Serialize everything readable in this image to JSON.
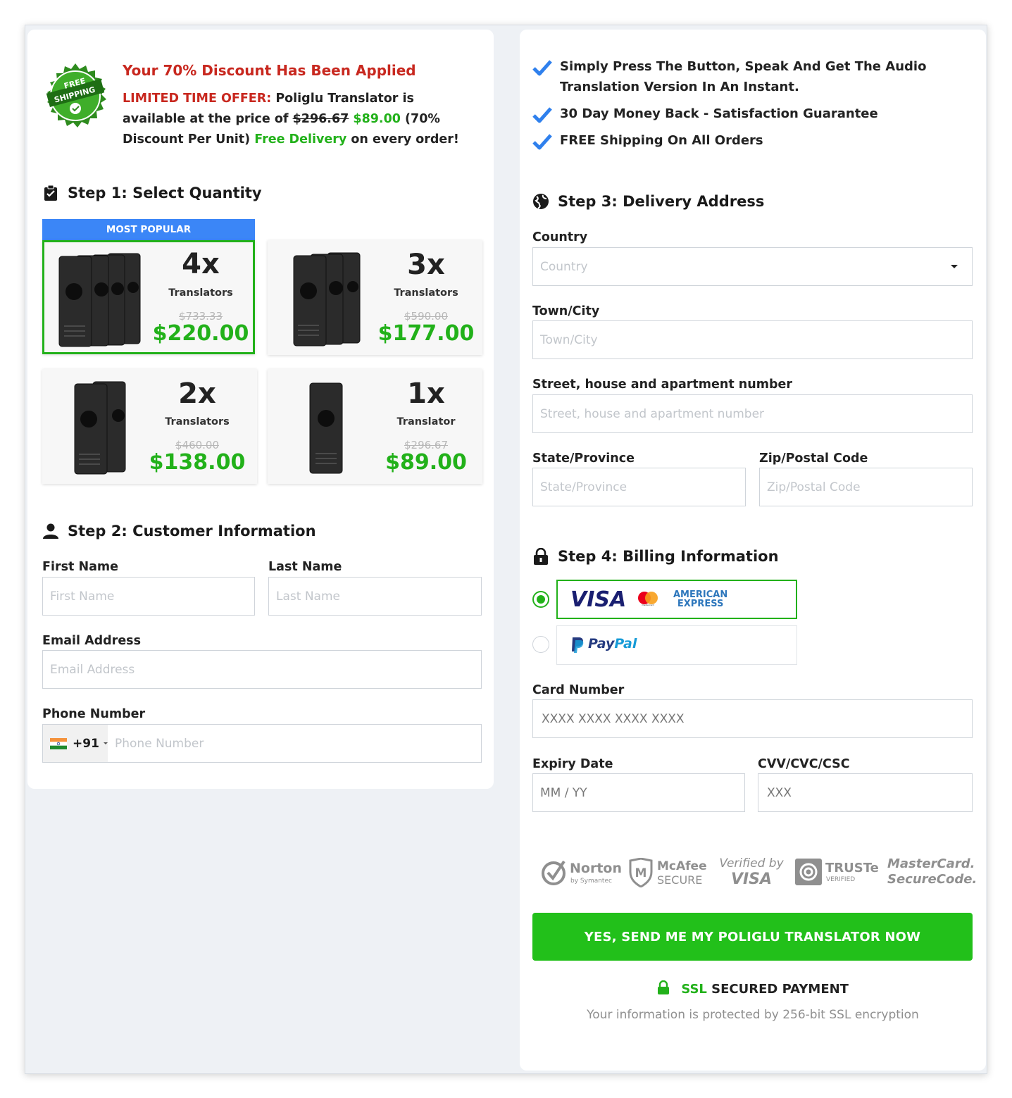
{
  "promo": {
    "title": "Your 70% Discount Has Been Applied",
    "offer_label": "LIMITED TIME OFFER:",
    "offer_text_1": " Poliglu Translator is available at the price of ",
    "old_price": "$296.67",
    "new_price": "$89.00",
    "offer_text_2": " (70% Discount Per Unit) ",
    "free_delivery": "Free Delivery",
    "offer_text_3": " on every order!",
    "badge_line1": "FREE",
    "badge_line2": "SHIPPING"
  },
  "step1": {
    "title": "Step 1: Select Quantity",
    "most_popular": "MOST POPULAR",
    "products": [
      {
        "qty": "4x",
        "unit": "Translators",
        "old_price": "$733.33",
        "price": "$220.00"
      },
      {
        "qty": "3x",
        "unit": "Translators",
        "old_price": "$590.00",
        "price": "$177.00"
      },
      {
        "qty": "2x",
        "unit": "Translators",
        "old_price": "$460.00",
        "price": "$138.00"
      },
      {
        "qty": "1x",
        "unit": "Translator",
        "old_price": "$296.67",
        "price": "$89.00"
      }
    ]
  },
  "step2": {
    "title": "Step 2: Customer Information",
    "first_name_label": "First Name",
    "first_name_placeholder": "First Name",
    "last_name_label": "Last Name",
    "last_name_placeholder": "Last Name",
    "email_label": "Email Address",
    "email_placeholder": "Email Address",
    "phone_label": "Phone Number",
    "phone_code": "+91",
    "phone_placeholder": "Phone Number"
  },
  "benefits": [
    "Simply Press The Button, Speak And Get The Audio Translation Version In An Instant.",
    "30 Day Money Back - Satisfaction Guarantee",
    "FREE Shipping On All Orders"
  ],
  "step3": {
    "title": "Step 3: Delivery Address",
    "country_label": "Country",
    "country_placeholder": "Country",
    "city_label": "Town/City",
    "city_placeholder": "Town/City",
    "street_label": "Street, house and apartment number",
    "street_placeholder": "Street, house and apartment number",
    "state_label": "State/Province",
    "state_placeholder": "State/Province",
    "zip_label": "Zip/Postal Code",
    "zip_placeholder": "Zip/Postal Code"
  },
  "step4": {
    "title": "Step 4: Billing Information",
    "visa_text": "VISA",
    "amex_line1": "AMERICAN",
    "amex_line2": "EXPRESS",
    "mastercard_small": "mastercard",
    "paypal_text_1": "Pay",
    "paypal_text_2": "Pal",
    "card_label": "Card Number",
    "card_placeholder": "XXXX XXXX XXXX XXXX",
    "expiry_label": "Expiry Date",
    "expiry_placeholder": "MM / YY",
    "cvv_label": "CVV/CVC/CSC",
    "cvv_placeholder": "XXX"
  },
  "trust_badges": {
    "norton": "Norton",
    "norton_sub": "by Symantec",
    "mcafee": "McAfee",
    "mcafee_sub": "SECURE",
    "verified_by": "Verified by",
    "verified_visa": "VISA",
    "truste": "TRUSTe",
    "truste_sub": "VERIFIED",
    "mc_line1": "MasterCard.",
    "mc_line2": "SecureCode."
  },
  "submit_label": "YES, SEND ME MY POLIGLU TRANSLATOR NOW",
  "ssl": {
    "ssl": "SSL",
    "secured": " SECURED PAYMENT",
    "note": "Your information is protected by 256-bit SSL encryption"
  },
  "colors": {
    "accent_green": "#22b11a",
    "accent_red": "#c8281f",
    "popular_blue": "#3b86f7",
    "check_blue": "#2f80ed"
  }
}
